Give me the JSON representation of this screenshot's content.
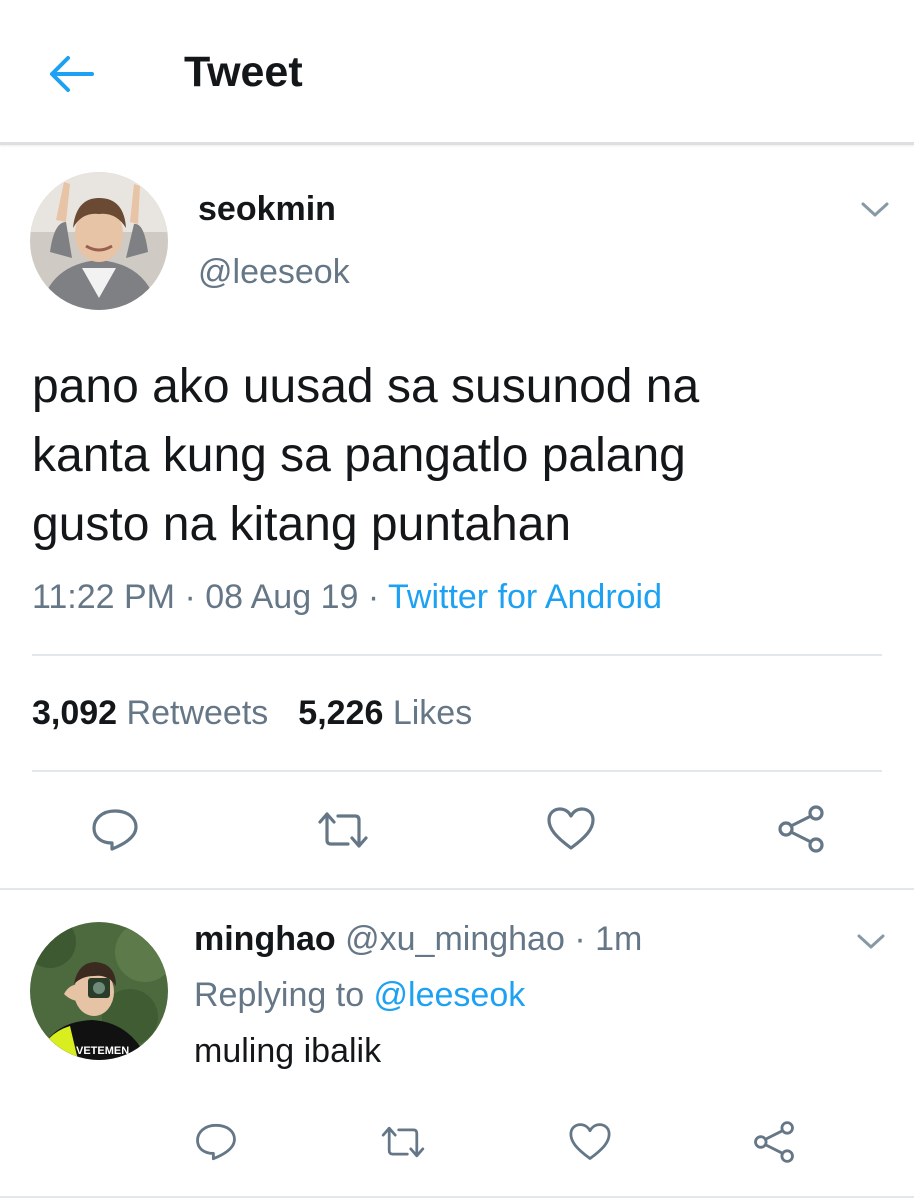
{
  "header": {
    "title": "Tweet"
  },
  "tweet": {
    "name": "seokmin",
    "handle": "@leeseok",
    "text": "pano ako uusad sa susunod na\nkanta kung sa pangatlo palang\ngusto na kitang puntahan",
    "time": "11:22 PM",
    "date": "08 Aug 19",
    "separator": " · ",
    "source": "Twitter for Android",
    "retweets_count": "3,092",
    "retweets_label": " Retweets",
    "likes_count": "5,226",
    "likes_label": " Likes"
  },
  "reply": {
    "name": "minghao",
    "handle": "@xu_minghao",
    "age": "1m",
    "separator": " · ",
    "replying_prefix": "Replying to ",
    "replying_to": "@leeseok",
    "text": "muling ibalik",
    "avatar_shirt_text": "VETEMEN"
  },
  "colors": {
    "accent": "#1da1f2",
    "text": "#14171a",
    "muted": "#657786",
    "divider": "#e1e8ed",
    "icon": "#657786"
  }
}
